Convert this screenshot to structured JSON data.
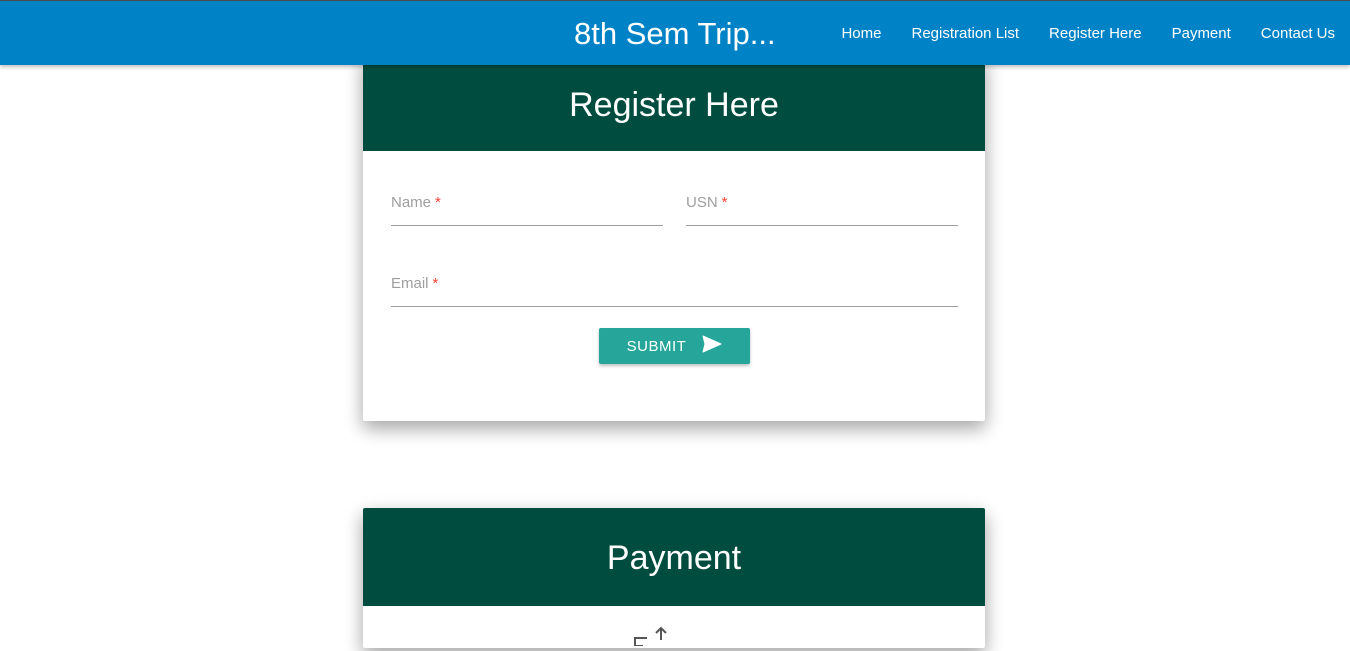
{
  "navbar": {
    "brand": "8th Sem Trip...",
    "links": [
      "Home",
      "Registration List",
      "Register Here",
      "Payment",
      "Contact Us"
    ]
  },
  "register": {
    "title": "Register Here",
    "fields": {
      "name": {
        "label": "Name",
        "required": "*",
        "value": ""
      },
      "usn": {
        "label": "USN",
        "required": "*",
        "value": ""
      },
      "email": {
        "label": "Email",
        "required": "*",
        "value": ""
      }
    },
    "submit_label": "SUBMIT",
    "submit_icon": "send-icon"
  },
  "payment": {
    "title": "Payment",
    "icon": "payment-transfer-icon"
  },
  "colors": {
    "navbar": "#0083c6",
    "card_header": "#004d40",
    "submit_button": "#26a69a",
    "required_marker": "#f44336"
  }
}
